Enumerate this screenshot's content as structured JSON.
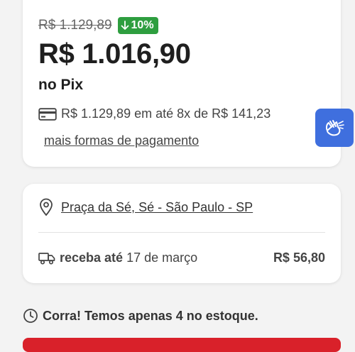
{
  "pricing": {
    "original_price": "R$ 1.129,89",
    "discount_label": "10%",
    "price": "R$ 1.016,90",
    "payment_method": "no Pix",
    "installments_text": "R$ 1.129,89 em até 8x de R$ 141,23",
    "more_payment_label": "mais formas de pagamento",
    "discount_color": "#2e9e3f"
  },
  "delivery": {
    "address": "Praça da Sé, Sé - São Paulo - SP",
    "receive_label": "receba até",
    "receive_date": "17 de março",
    "shipping_price": "R$ 56,80"
  },
  "stock": {
    "message": "Corra! Temos apenas 4 no estoque."
  },
  "colors": {
    "buy_button": "#d9212a",
    "accessibility_button": "#3f6fde"
  }
}
